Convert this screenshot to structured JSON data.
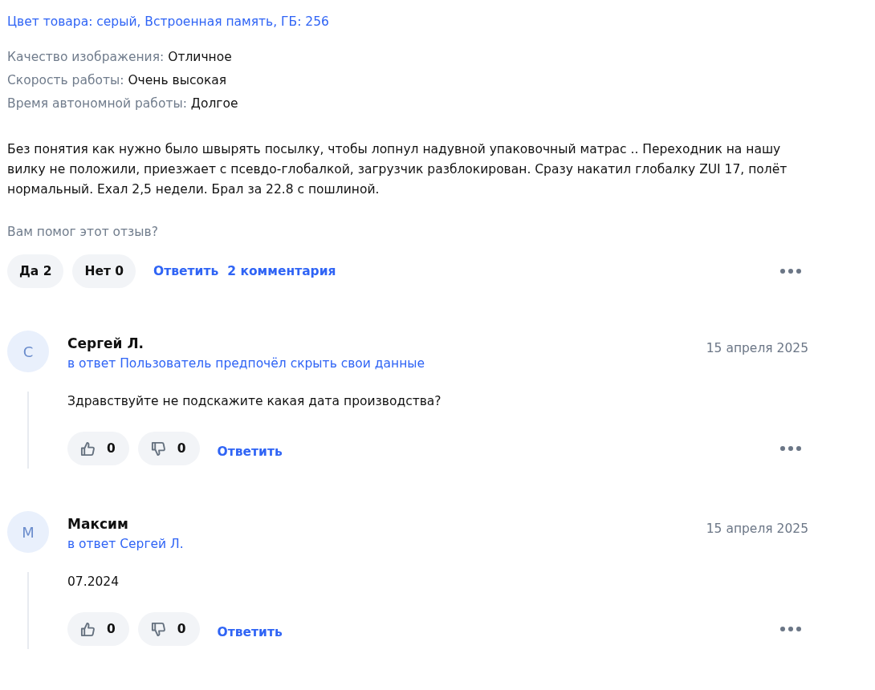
{
  "product_variant": "Цвет товара: серый, Встроенная память, ГБ: 256",
  "ratings": [
    {
      "label": "Качество изображения:",
      "value": "Отличное"
    },
    {
      "label": "Скорость работы:",
      "value": "Очень высокая"
    },
    {
      "label": "Время автономной работы:",
      "value": "Долгое"
    }
  ],
  "review_text": "Без понятия как нужно было швырять посылку, чтобы лопнул надувной упаковочный матрас .. Переходник на нашу вилку не положили, приезжает с псевдо-глобалкой, загрузчик разблокирован. Сразу накатил глобалку ZUI 17, полёт нормальный. Ехал 2,5 недели. Брал за 22.8 с пошлиной.",
  "helpful_prompt": "Вам помог этот отзыв?",
  "actions": {
    "yes": "Да 2",
    "no": "Нет 0",
    "reply": "Ответить",
    "comments": "2 комментария"
  },
  "comments": [
    {
      "avatar_letter": "С",
      "author": "Сергей Л.",
      "reply_to": "в ответ Пользователь предпочёл скрыть свои данные",
      "date": "15 апреля 2025",
      "text": "Здравствуйте не подскажите какая дата производства?",
      "likes": "0",
      "dislikes": "0",
      "reply": "Ответить"
    },
    {
      "avatar_letter": "М",
      "author": "Максим",
      "reply_to": "в ответ Сергей Л.",
      "date": "15 апреля 2025",
      "text": "07.2024",
      "likes": "0",
      "dislikes": "0",
      "reply": "Ответить"
    }
  ]
}
